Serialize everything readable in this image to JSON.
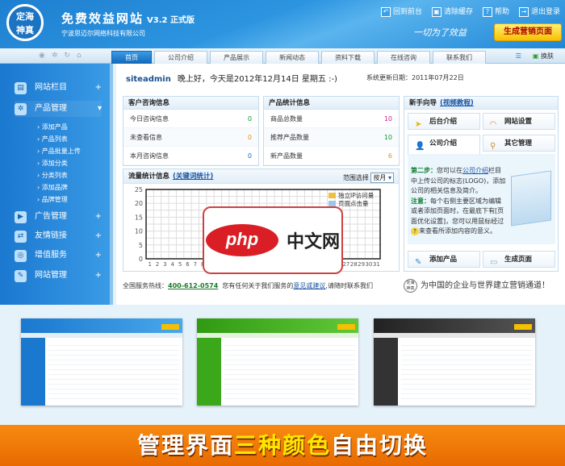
{
  "header": {
    "logo_text": "定海神真",
    "title": "免费效益网站",
    "version": "V3.2 正式版",
    "company": "宁波思迈尔网络科技有限公司",
    "links": [
      {
        "icon": "back-icon",
        "label": "回到前台"
      },
      {
        "icon": "trash-icon",
        "label": "清除缓存"
      },
      {
        "icon": "help-icon",
        "label": "帮助"
      },
      {
        "icon": "logout-icon",
        "label": "退出登录"
      }
    ],
    "slogan": "一切为了效益",
    "generate_button": "生成营销页面"
  },
  "nav": {
    "tabs": [
      "首页",
      "公司介绍",
      "产品展示",
      "新闻动态",
      "资料下载",
      "在线咨询",
      "联系我们"
    ],
    "skin": "换肤"
  },
  "sidebar": {
    "items": [
      {
        "label": "网站栏目",
        "icon": "columns-icon"
      },
      {
        "label": "产品管理",
        "icon": "gear-icon"
      },
      {
        "label": "广告管理",
        "icon": "monitor-icon"
      },
      {
        "label": "友情链接",
        "icon": "link-icon"
      },
      {
        "label": "增值服务",
        "icon": "chat-icon"
      },
      {
        "label": "网站管理",
        "icon": "tools-icon"
      }
    ],
    "sub_items": [
      "添加产品",
      "产品列表",
      "产品批量上传",
      "添加分类",
      "分类列表",
      "添加品牌",
      "品牌管理"
    ]
  },
  "main": {
    "user": "siteadmin",
    "greeting": "晚上好，今天是2012年12月14日 星期五 :-)",
    "update_date": "系统更新日期：2011年07月22日",
    "customer": {
      "title": "客户咨询信息",
      "rows": [
        {
          "label": "今日咨询信息",
          "value": "0",
          "color": "#0a9a2a"
        },
        {
          "label": "未查看信息",
          "value": "0",
          "color": "#e8901a"
        },
        {
          "label": "本月咨询信息",
          "value": "0",
          "color": "#1a6ad0"
        }
      ]
    },
    "product": {
      "title": "产品统计信息",
      "rows": [
        {
          "label": "商品总数量",
          "value": "10",
          "color": "#d0208a"
        },
        {
          "label": "推荐产品数量",
          "value": "10",
          "color": "#0a9a2a"
        },
        {
          "label": "新产品数量",
          "value": "6",
          "color": "#e8901a"
        }
      ]
    },
    "traffic": {
      "title": "流量统计信息",
      "link": "(关键词统计)",
      "range_label": "范围选择",
      "range_value": "按月",
      "legend": [
        "独立IP访问量",
        "页面点击量"
      ]
    },
    "guide": {
      "title": "新手向导",
      "link": "(视频教程)",
      "buttons": [
        "后台介绍",
        "网站设置",
        "公司介绍",
        "其它管理",
        "添加产品",
        "生成页面"
      ],
      "step": "第二步：",
      "text1": "您可以在",
      "link_text": "公司介绍",
      "text2": "栏目中上传公司的标志(LOGO)，添加公司的相关信息及简介。",
      "note": "注意：",
      "text3": "每个右侧主要区域为编辑或者添加页面时，在最底下有[页面优化设置]，您可以用鼠标经过",
      "text4": "来查看所添加内容的意义。"
    },
    "footer": {
      "hotline_label": "全国服务热线：",
      "hotline": "400-612-0574",
      "text1": "您有任何关于我们服务的",
      "link": "意见或建议",
      "text2": ",请随时联系我们",
      "slogan": "为中国的企业与世界建立营销通道！"
    }
  },
  "watermark": {
    "logo": "php",
    "text": "中文网"
  },
  "themes": [
    {
      "name": "blue",
      "color": "#1a78cf"
    },
    {
      "name": "green",
      "color": "#3aa81a"
    },
    {
      "name": "black",
      "color": "#333333"
    }
  ],
  "banner": {
    "part1": "管理界面",
    "part2": "三种颜色",
    "part3": "自由切换"
  },
  "chart_data": {
    "type": "line",
    "title": "流量统计信息",
    "x": [
      1,
      2,
      3,
      4,
      5,
      6,
      7,
      8,
      9,
      10,
      11,
      12,
      13,
      14,
      15,
      16,
      17,
      18,
      19,
      20,
      21,
      22,
      23,
      24,
      25,
      26,
      27,
      28,
      29,
      30,
      31
    ],
    "ylim": [
      0,
      25
    ],
    "yticks": [
      0,
      5,
      10,
      15,
      20,
      25
    ],
    "series": [
      {
        "name": "独立IP访问量",
        "values": []
      },
      {
        "name": "页面点击量",
        "values": []
      }
    ]
  }
}
